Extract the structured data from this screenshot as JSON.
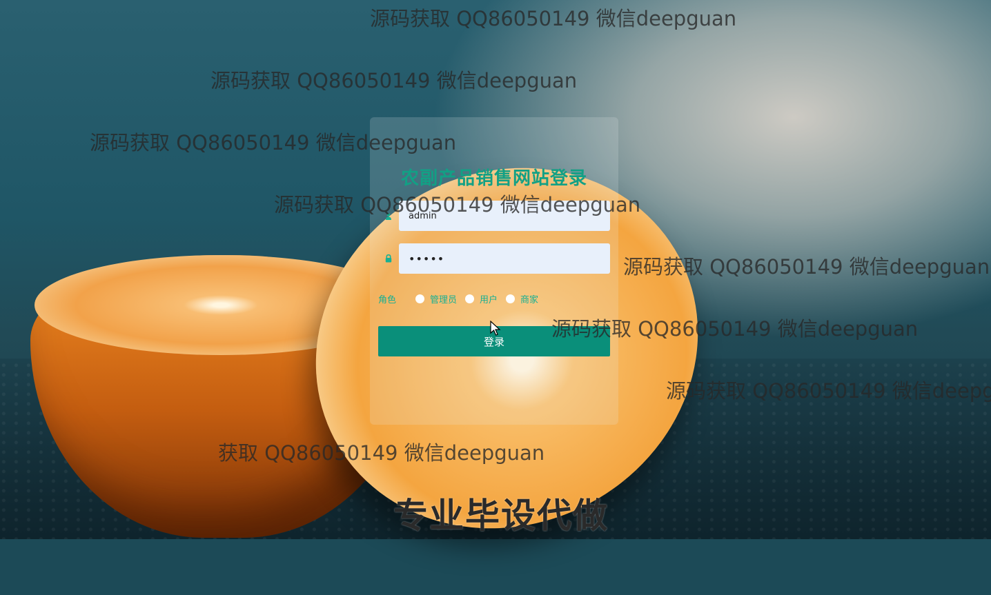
{
  "login": {
    "title": "农副产品销售网站登录",
    "username_value": "admin",
    "password_value": "•••••",
    "role_label": "角色",
    "roles": [
      "管理员",
      "用户",
      "商家"
    ],
    "submit_label": "登录"
  },
  "watermarks": [
    "源码获取 QQ86050149 微信deepguan",
    "源码获取 QQ86050149 微信deepguan",
    "源码获取 QQ86050149 微信deepguan",
    "源码获取 QQ86050149 微信deepguan",
    "源码获取 QQ86050149 微信deepguan",
    "源码获取 QQ86050149 微信deepguan",
    "源码获取 QQ86050149 微信deepg",
    "获取 QQ86050149 微信deepguan"
  ],
  "banner": "专业毕设代做",
  "colors": {
    "accent": "#12a085",
    "button": "#0a8f7a",
    "input_bg": "#e8f0fb"
  },
  "icons": [
    "user-icon",
    "lock-icon",
    "mouse-cursor-icon"
  ]
}
